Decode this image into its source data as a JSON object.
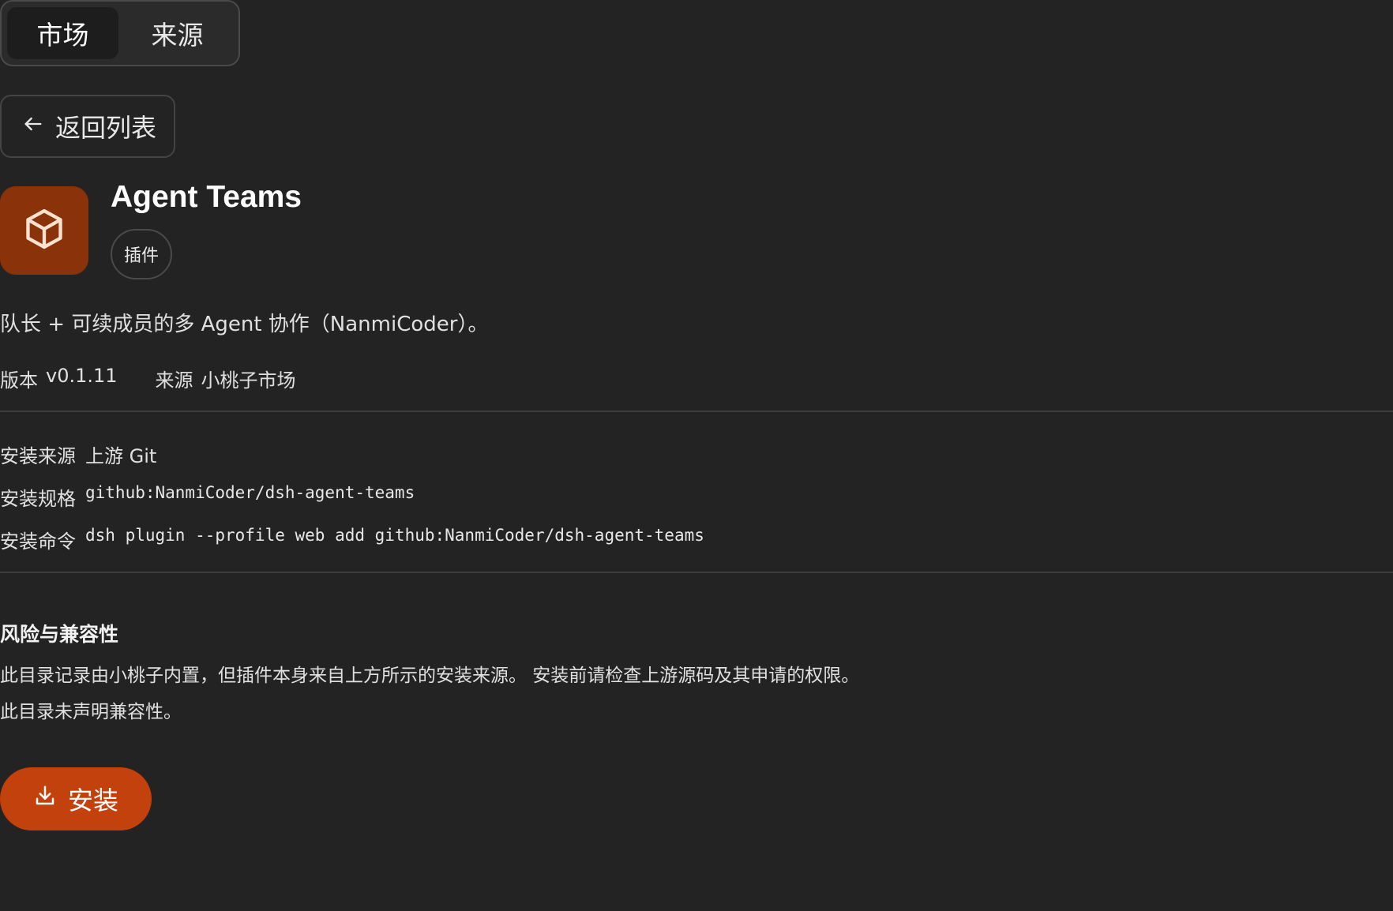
{
  "tabs": [
    {
      "label": "市场",
      "active": true
    },
    {
      "label": "来源",
      "active": false
    }
  ],
  "back_button": {
    "label": "返回列表",
    "icon": "arrow-left-icon"
  },
  "plugin": {
    "icon": "box-icon",
    "icon_bg": "#8a3209",
    "name": "Agent Teams",
    "type_badge": "插件",
    "description": "队长 + 可续成员的多 Agent 协作（NanmiCoder）。",
    "version_label": "版本",
    "version": "v0.1.11",
    "source_label": "来源",
    "source": "小桃子市场"
  },
  "install_info": {
    "source_label": "安装来源",
    "source_value": "上游 Git",
    "spec_label": "安装规格",
    "spec_value": "github:NanmiCoder/dsh-agent-teams",
    "command_label": "安装命令",
    "command_value": "dsh plugin --profile web add github:NanmiCoder/dsh-agent-teams"
  },
  "risk": {
    "title": "风险与兼容性",
    "line1": "此目录记录由小桃子内置，但插件本身来自上方所示的安装来源。 安装前请检查上游源码及其申请的权限。",
    "line2": "此目录未声明兼容性。"
  },
  "install_button": {
    "label": "安装",
    "icon": "download-icon",
    "color": "#c2410c"
  }
}
